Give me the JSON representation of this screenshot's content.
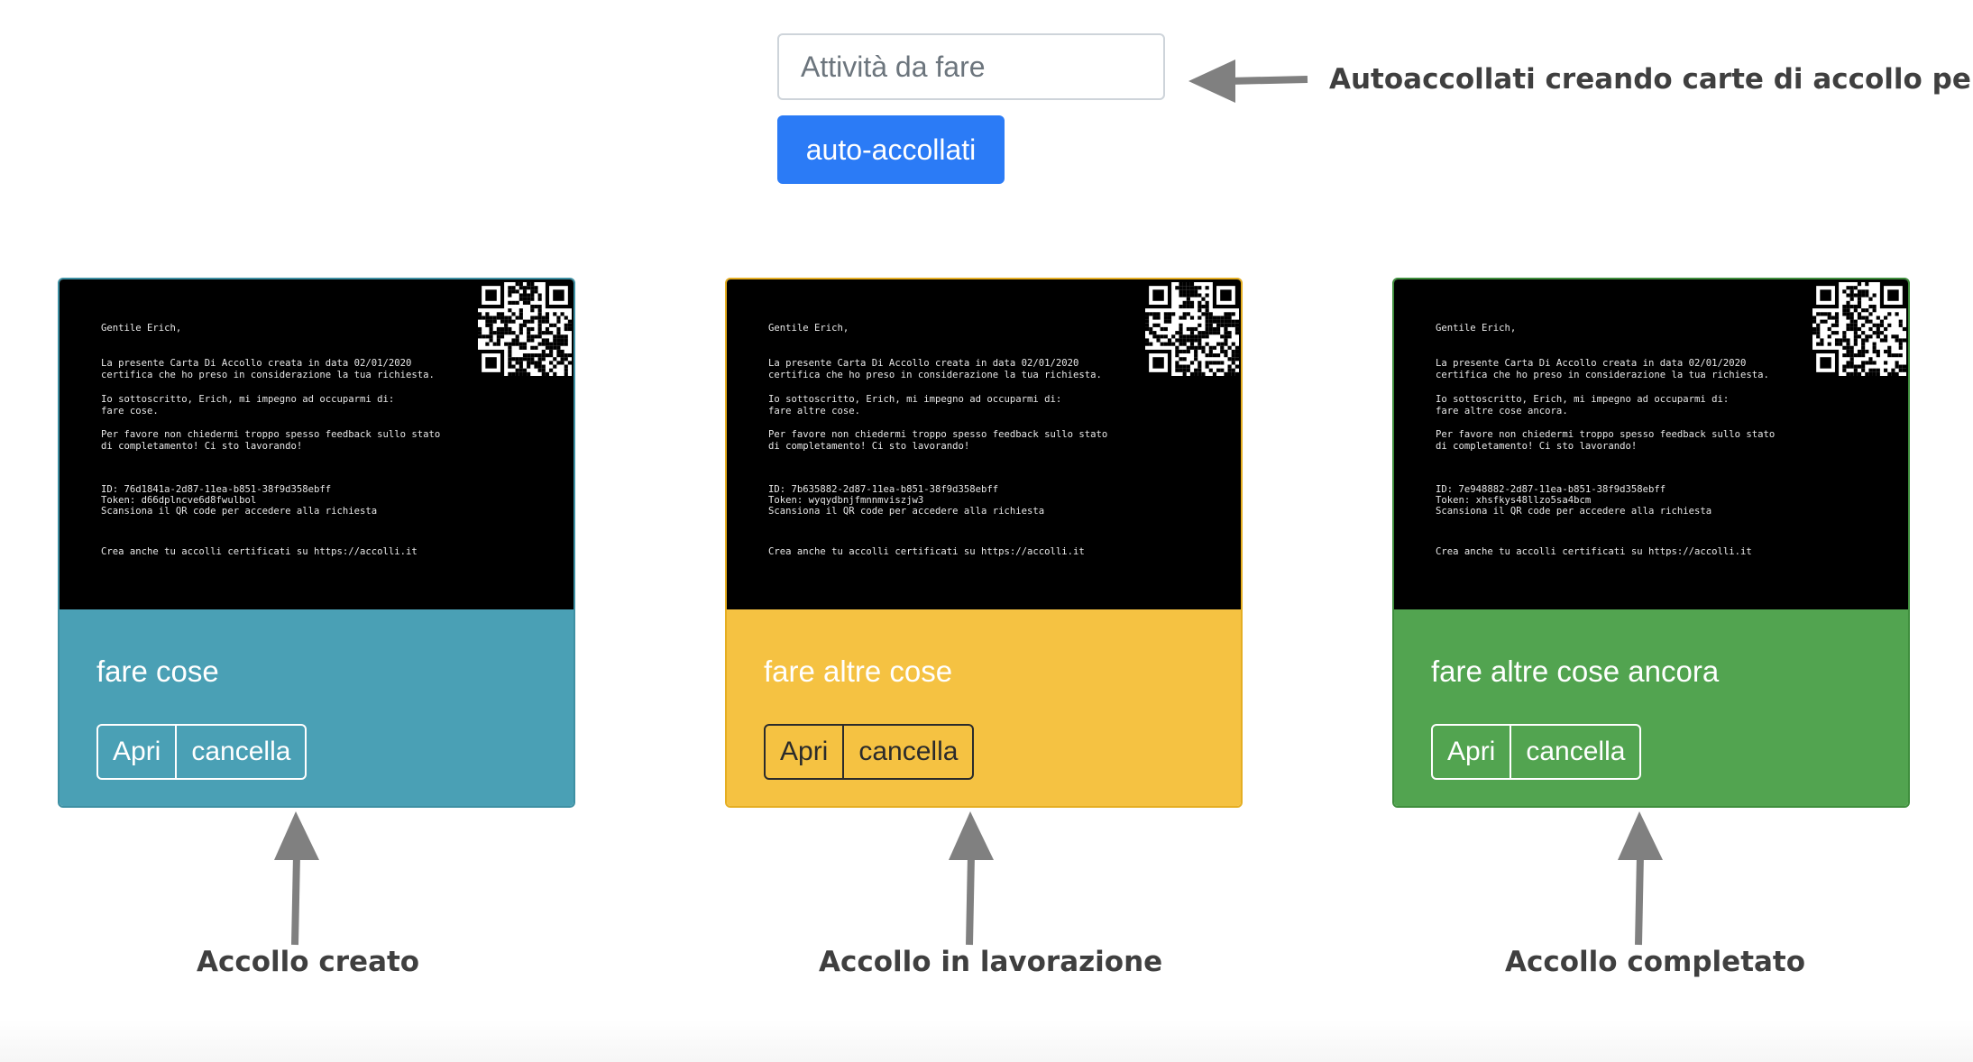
{
  "form": {
    "input_placeholder": "Attività da fare",
    "input_value": "",
    "submit_label": "auto-accollati"
  },
  "annotations": {
    "top": "Autoaccollati creando carte di accollo per te!",
    "created": "Accollo creato",
    "in_progress": "Accollo in lavorazione",
    "completed": "Accollo completato"
  },
  "cards": [
    {
      "title": "fare cose",
      "status_color": "#4aa0b5",
      "open_label": "Apri",
      "delete_label": "cancella",
      "cert": {
        "greeting": "Gentile Erich,",
        "p1a": "La presente Carta Di Accollo creata in data 02/01/2020",
        "p1b": "certifica che ho preso in considerazione la tua richiesta.",
        "p2a": "Io sottoscritto, Erich, mi impegno ad occuparmi di:",
        "p2b": "fare cose.",
        "p3a": "Per favore non chiedermi troppo spesso feedback sullo stato",
        "p3b": "di completamento! Ci sto lavorando!",
        "id": "ID: 76d1841a-2d87-11ea-b851-38f9d358ebff",
        "token": "Token: d66dplncve6d8fwulbol",
        "scan": "Scansiona il QR code per accedere alla richiesta",
        "footer": "Crea anche tu accolli certificati su https://accolli.it"
      }
    },
    {
      "title": "fare altre cose",
      "status_color": "#f5c242",
      "open_label": "Apri",
      "delete_label": "cancella",
      "cert": {
        "greeting": "Gentile Erich,",
        "p1a": "La presente Carta Di Accollo creata in data 02/01/2020",
        "p1b": "certifica che ho preso in considerazione la tua richiesta.",
        "p2a": "Io sottoscritto, Erich, mi impegno ad occuparmi di:",
        "p2b": "fare altre cose.",
        "p3a": "Per favore non chiedermi troppo spesso feedback sullo stato",
        "p3b": "di completamento! Ci sto lavorando!",
        "id": "ID: 7b635882-2d87-11ea-b851-38f9d358ebff",
        "token": "Token: wyqydbnjfmnnmviszjw3",
        "scan": "Scansiona il QR code per accedere alla richiesta",
        "footer": "Crea anche tu accolli certificati su https://accolli.it"
      }
    },
    {
      "title": "fare altre cose ancora",
      "status_color": "#52a450",
      "open_label": "Apri",
      "delete_label": "cancella",
      "cert": {
        "greeting": "Gentile Erich,",
        "p1a": "La presente Carta Di Accollo creata in data 02/01/2020",
        "p1b": "certifica che ho preso in considerazione la tua richiesta.",
        "p2a": "Io sottoscritto, Erich, mi impegno ad occuparmi di:",
        "p2b": "fare altre cose ancora.",
        "p3a": "Per favore non chiedermi troppo spesso feedback sullo stato",
        "p3b": "di completamento! Ci sto lavorando!",
        "id": "ID: 7e948882-2d87-11ea-b851-38f9d358ebff",
        "token": "Token: xhsfkys48llzo5sa4bcm",
        "scan": "Scansiona il QR code per accedere alla richiesta",
        "footer": "Crea anche tu accolli certificati su https://accolli.it"
      }
    }
  ]
}
